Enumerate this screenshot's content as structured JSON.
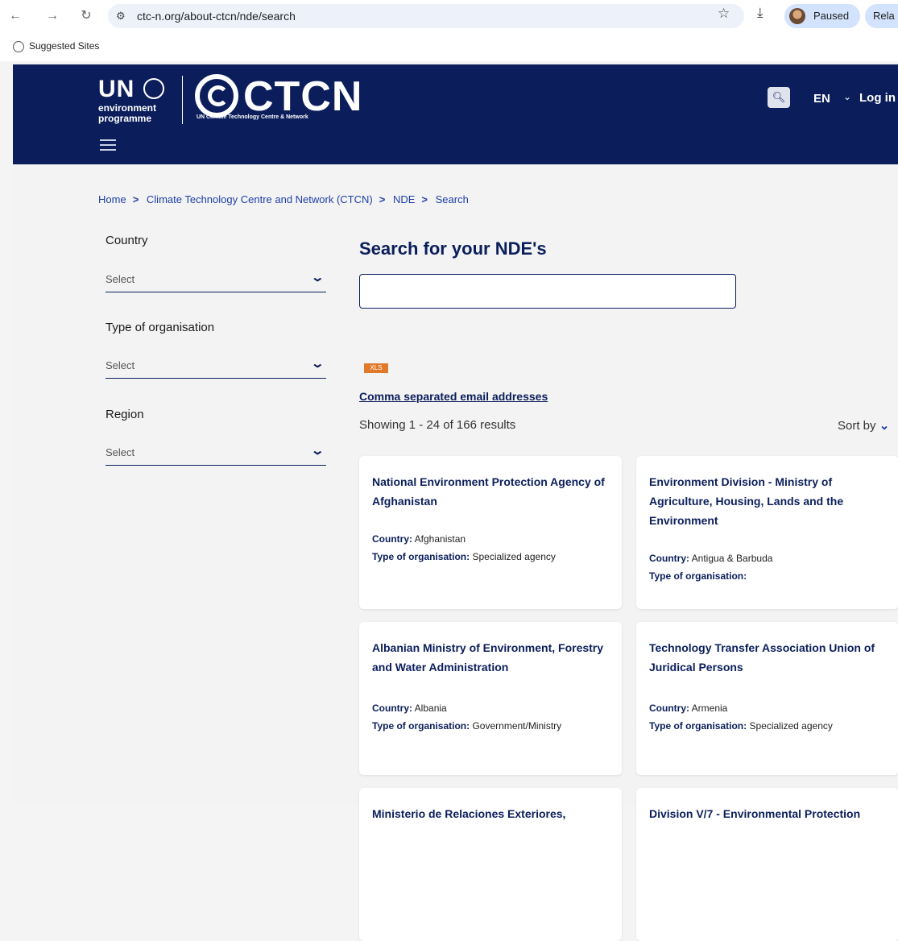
{
  "browser": {
    "url": "ctc-n.org/about-ctcn/nde/search",
    "profile_label": "Paused",
    "relaunch_label": "Rela",
    "bookmark_label": "Suggested Sites"
  },
  "header": {
    "unep_un": "UN",
    "unep_line1": "environment",
    "unep_line2": "programme",
    "ctcn_word": "CTCN",
    "ctcn_sub": "UN Climate Technology Centre & Network",
    "lang": "EN",
    "login": "Log in"
  },
  "breadcrumb": [
    "Home",
    "Climate Technology Centre and Network (CTCN)",
    "NDE",
    "Search"
  ],
  "filters": [
    {
      "label": "Country",
      "value": "Select"
    },
    {
      "label": "Type of organisation",
      "value": "Select"
    },
    {
      "label": "Region",
      "value": "Select"
    }
  ],
  "main": {
    "title": "Search for your NDE's",
    "search_value": "",
    "xls_label": "XLS",
    "email_link": "Comma separated email addresses",
    "results_count": "Showing 1 - 24 of 166 results",
    "sort_label": "Sort by"
  },
  "meta_labels": {
    "country": "Country:",
    "type": "Type of organisation:"
  },
  "cards": [
    {
      "title": "National Environment Protection Agency of Afghanistan",
      "country": "Afghanistan",
      "type": "Specialized agency"
    },
    {
      "title": "Environment Division - Ministry of Agriculture, Housing, Lands and the Environment",
      "country": "Antigua & Barbuda",
      "type": ""
    },
    {
      "title": "Albanian Ministry of Environment, Forestry and Water Administration",
      "country": "Albania",
      "type": "Government/Ministry"
    },
    {
      "title": "Technology Transfer Association Union of Juridical Persons",
      "country": "Armenia",
      "type": "Specialized agency"
    },
    {
      "title": "Ministerio de Relaciones Exteriores,",
      "country": "",
      "type": ""
    },
    {
      "title": "Division V/7 - Environmental Protection",
      "country": "",
      "type": ""
    }
  ]
}
